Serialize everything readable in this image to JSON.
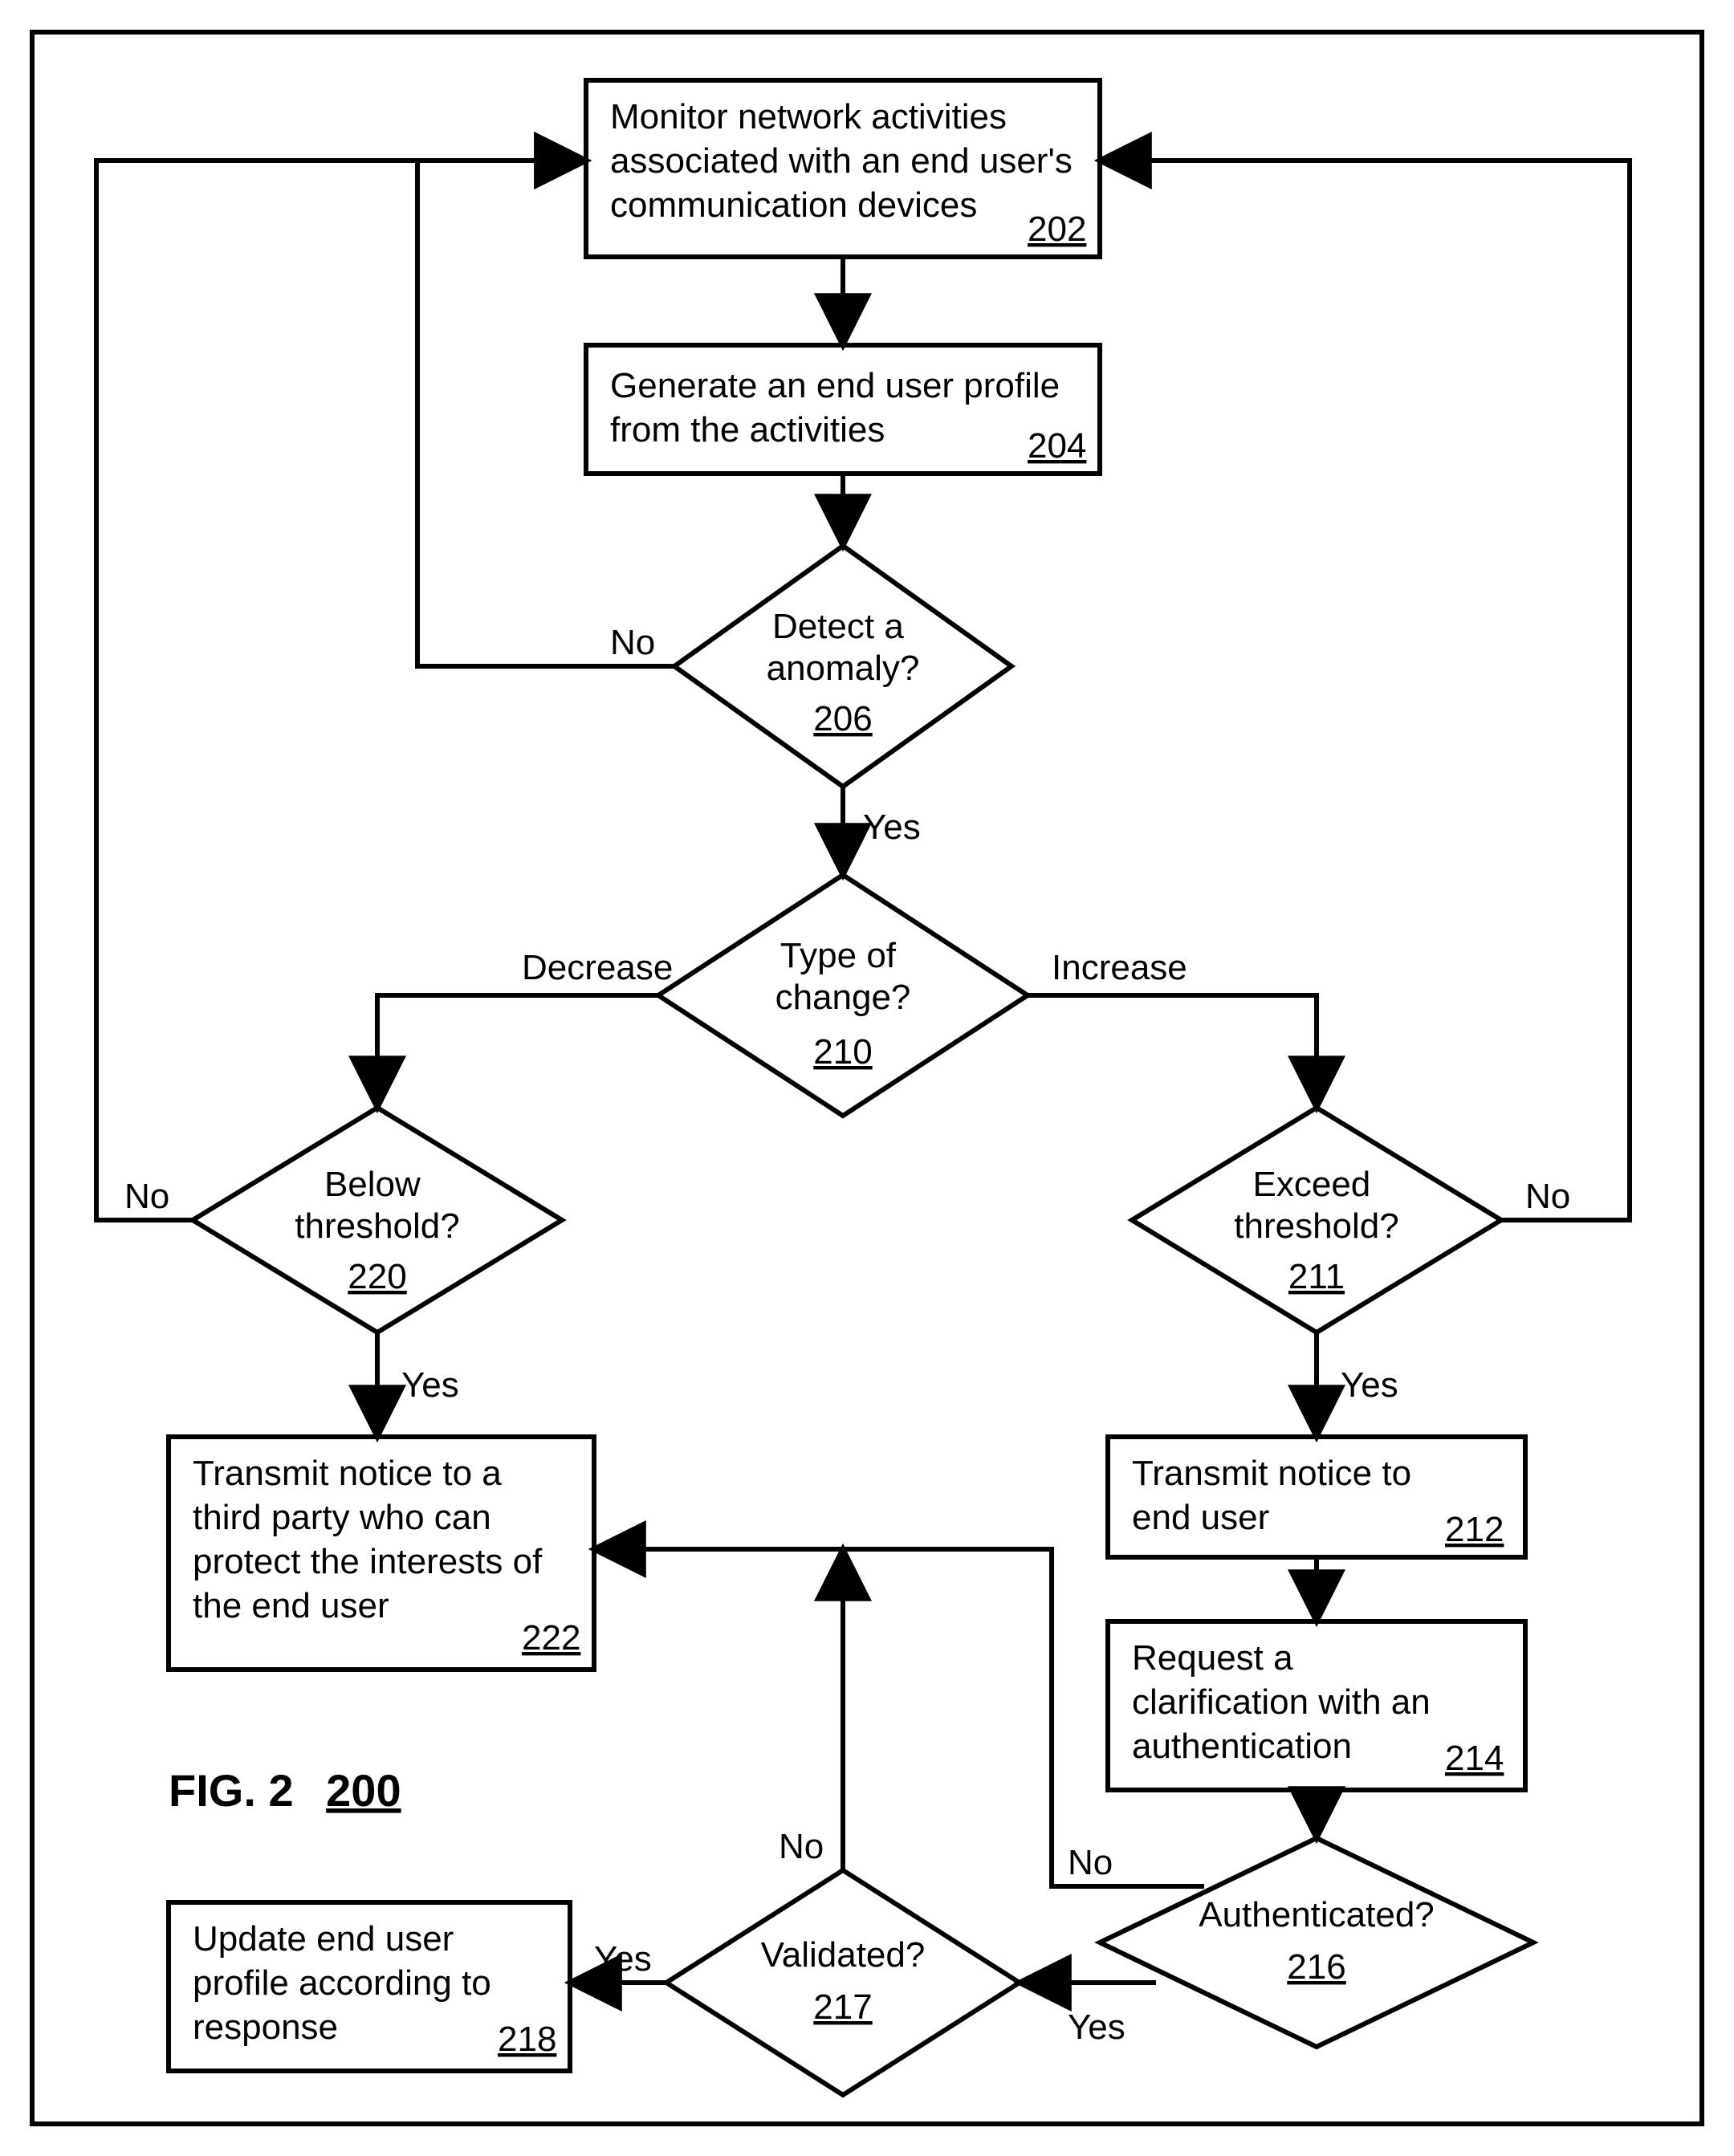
{
  "figure": {
    "label": "FIG. 2",
    "ref": "200"
  },
  "nodes": {
    "n202": {
      "text": "Monitor network activities associated with an end user's communication devices",
      "ref": "202"
    },
    "n204": {
      "text": "Generate an end user profile from the activities",
      "ref": "204"
    },
    "n206": {
      "text": "Detect a anomaly?",
      "ref": "206"
    },
    "n210": {
      "text": "Type of change?",
      "ref": "210"
    },
    "n211": {
      "text": "Exceed threshold?",
      "ref": "211"
    },
    "n212": {
      "text": "Transmit notice to end user",
      "ref": "212"
    },
    "n214": {
      "text": "Request a clarification with an authentication",
      "ref": "214"
    },
    "n216": {
      "text": "Authenticated?",
      "ref": "216"
    },
    "n217": {
      "text": "Validated?",
      "ref": "217"
    },
    "n218": {
      "text": "Update end user profile according to response",
      "ref": "218"
    },
    "n220": {
      "text": "Below threshold?",
      "ref": "220"
    },
    "n222": {
      "text": "Transmit notice to a third party who can protect the interests of the end user",
      "ref": "222"
    }
  },
  "labels": {
    "yes": "Yes",
    "no": "No",
    "increase": "Increase",
    "decrease": "Decrease"
  }
}
